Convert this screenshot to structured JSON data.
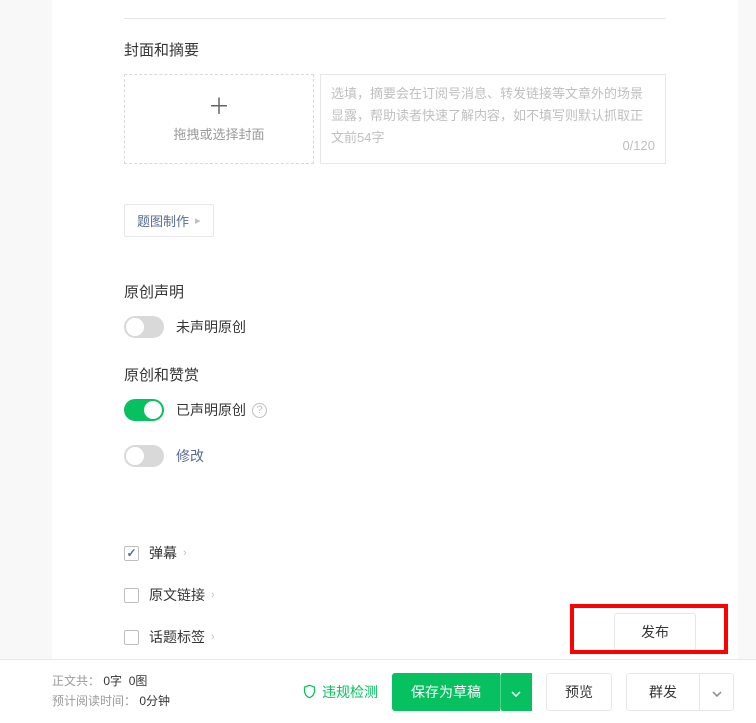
{
  "cover_summary": {
    "title": "封面和摘要",
    "drop_hint": "拖拽或选择封面",
    "summary_placeholder": "选填，摘要会在订阅号消息、转发链接等文章外的场景显露，帮助读者快速了解内容，如不填写则默认抓取正文前54字",
    "summary_count": "0/120"
  },
  "cover_maker": {
    "label": "题图制作"
  },
  "original": {
    "title": "原创声明",
    "toggle_off_label": "未声明原创"
  },
  "reward": {
    "title": "原创和赞赏",
    "toggle_on_label": "已声明原创",
    "modify_label": "修改"
  },
  "options": {
    "danmu": "弹幕",
    "source_link": "原文链接",
    "topic_tag": "话题标签"
  },
  "publish": {
    "label": "发布"
  },
  "footer": {
    "stats_prefix": "正文共：",
    "word_count": "0字",
    "image_count": "0图",
    "read_time_prefix": "预计阅读时间：",
    "read_time": "0分钟",
    "violate": "违规检测",
    "save_draft": "保存为草稿",
    "preview": "预览",
    "mass_send": "群发"
  }
}
